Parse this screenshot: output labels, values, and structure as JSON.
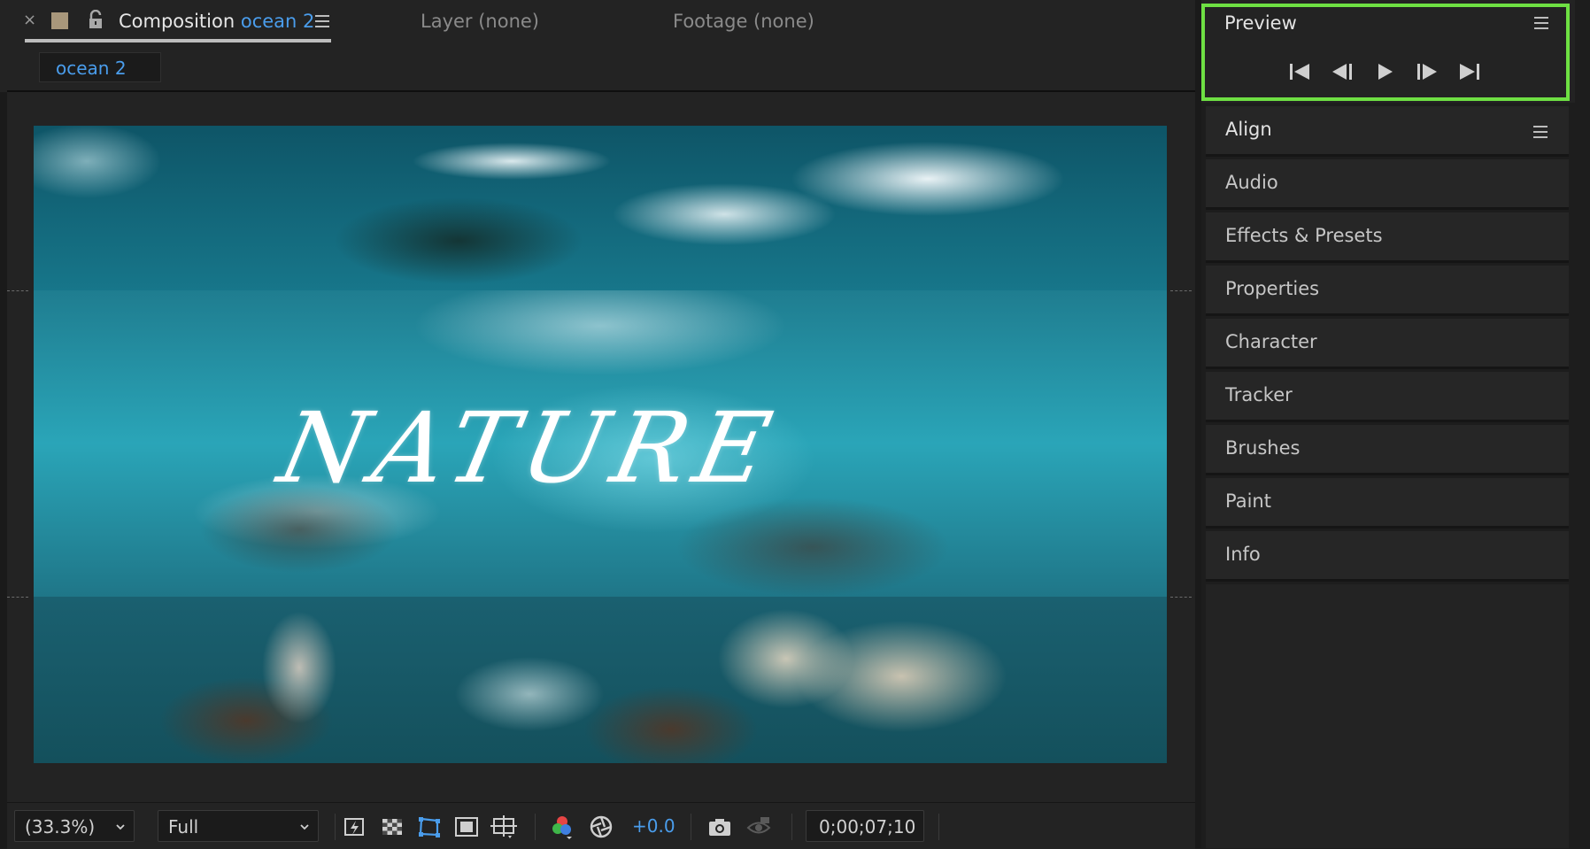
{
  "composition_tab": {
    "close_glyph": "×",
    "label_type": "Composition",
    "comp_name": "ocean 2",
    "swatch_color": "#a8977b",
    "accent_color": "#4a9dec"
  },
  "other_tabs": {
    "layer": "Layer (none)",
    "footage": "Footage (none)"
  },
  "subtab": {
    "label": "ocean 2"
  },
  "frame": {
    "title_text": "NATURE"
  },
  "viewer_toolbar": {
    "magnification": "(33.3%)",
    "resolution": "Full",
    "exposure": "+0.0",
    "timecode": "0;00;07;10",
    "icons": [
      "fast-previews-icon",
      "transparency-grid-icon",
      "mask-path-icon",
      "region-of-interest-icon",
      "guides-grid-icon",
      "color-channels-icon",
      "reset-exposure-icon",
      "snapshot-icon",
      "show-snapshot-icon"
    ]
  },
  "preview_panel": {
    "title": "Preview",
    "highlight_color": "#6ee043",
    "controls": [
      "first-frame-icon",
      "previous-frame-icon",
      "play-icon",
      "next-frame-icon",
      "last-frame-icon"
    ]
  },
  "panels": [
    {
      "label": "Align"
    },
    {
      "label": "Audio"
    },
    {
      "label": "Effects & Presets"
    },
    {
      "label": "Properties"
    },
    {
      "label": "Character"
    },
    {
      "label": "Tracker"
    },
    {
      "label": "Brushes"
    },
    {
      "label": "Paint"
    },
    {
      "label": "Info"
    }
  ]
}
